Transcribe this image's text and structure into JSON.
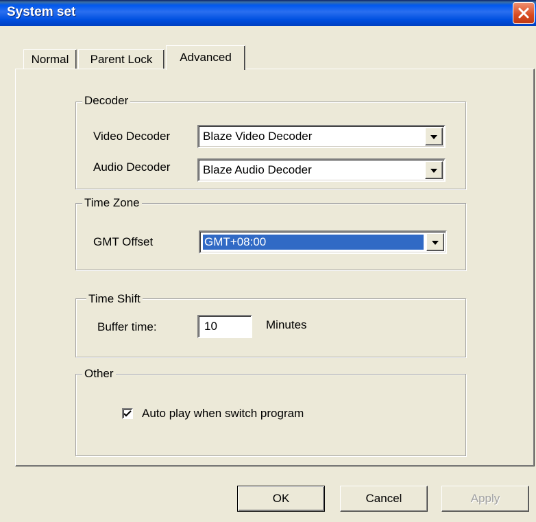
{
  "window": {
    "title": "System set"
  },
  "tabs": [
    {
      "label": "Normal"
    },
    {
      "label": "Parent Lock"
    },
    {
      "label": "Advanced"
    }
  ],
  "decoder": {
    "group_label": "Decoder",
    "video_label": "Video Decoder",
    "video_value": "Blaze Video Decoder",
    "audio_label": "Audio Decoder",
    "audio_value": "Blaze Audio Decoder"
  },
  "timezone": {
    "group_label": "Time Zone",
    "gmt_label": "GMT Offset",
    "gmt_value": "GMT+08:00"
  },
  "timeshift": {
    "group_label": "Time Shift",
    "buffer_label": "Buffer time:",
    "buffer_value": "10",
    "unit_label": "Minutes"
  },
  "other": {
    "group_label": "Other",
    "autoplay_label": "Auto play when switch program",
    "autoplay_checked": true
  },
  "buttons": {
    "ok": "OK",
    "cancel": "Cancel",
    "apply": "Apply"
  },
  "icons": {
    "close": "close-icon",
    "dropdown": "chevron-down-icon",
    "check": "check-icon"
  }
}
